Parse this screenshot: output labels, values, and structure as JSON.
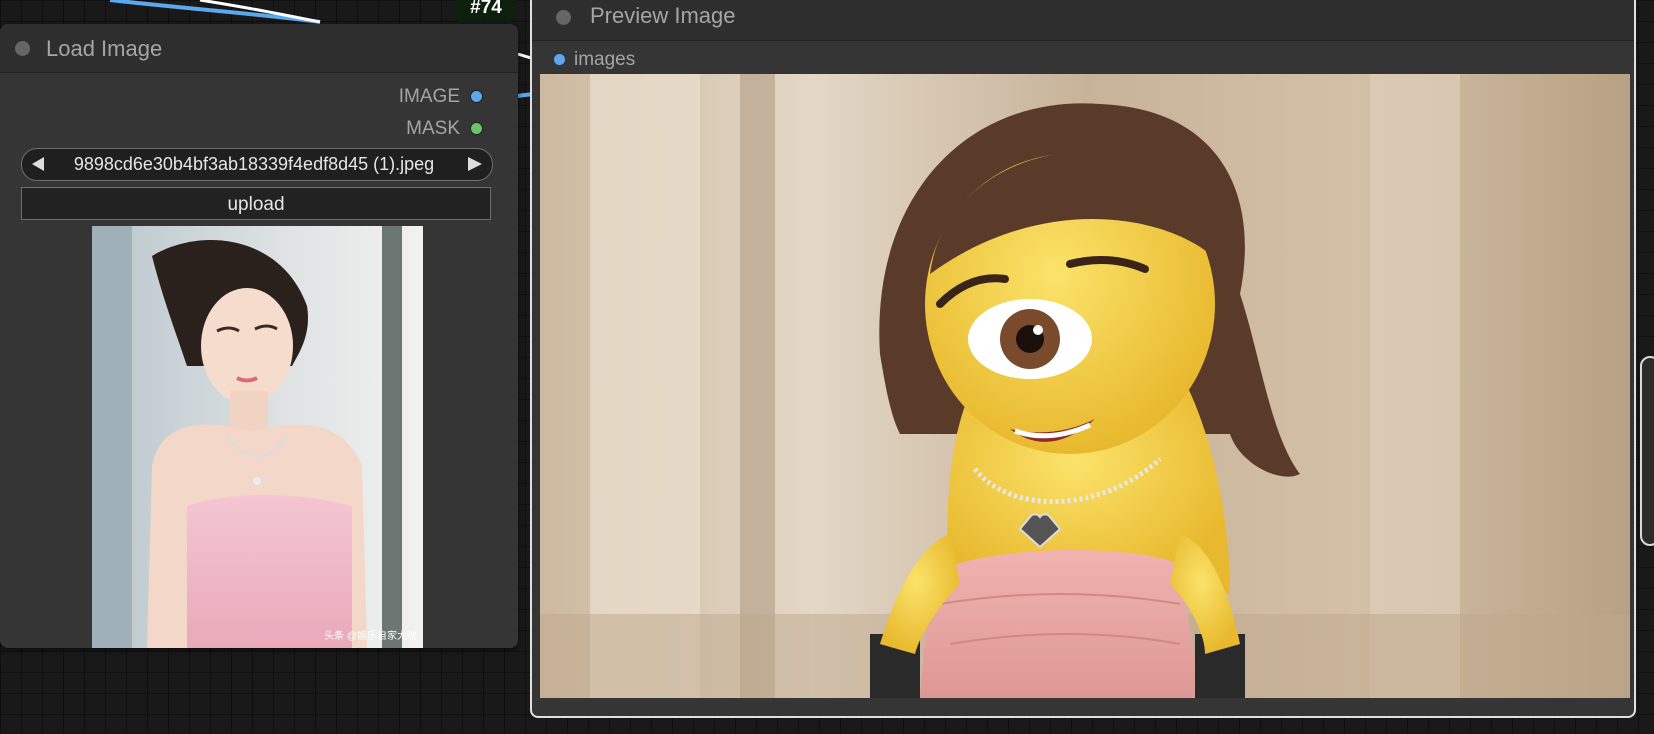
{
  "canvas": {
    "node_badge": "#74"
  },
  "load_image_node": {
    "title": "Load Image",
    "outputs": [
      {
        "label": "IMAGE",
        "color": "#5aa9ef"
      },
      {
        "label": "MASK",
        "color": "#6cc46c"
      }
    ],
    "image_combo": {
      "value": "9898cd6e30b4bf3ab18339f4edf8d45 (1).jpeg"
    },
    "upload_label": "upload",
    "thumbnail": {
      "subject": "woman-in-pink-strapless-dress-photo",
      "watermark": "头条 @娱乐自家大咖"
    }
  },
  "preview_image_node": {
    "title": "Preview Image",
    "inputs": [
      {
        "label": "images",
        "color": "#5aa9ef"
      }
    ],
    "image": {
      "subject": "yellow-one-eyed-minion-character-with-brown-hair-pink-dress"
    }
  },
  "colors": {
    "canvas_bg": "#191919",
    "node_bg": "#353535",
    "link_image": "#5aa9ef",
    "link_white": "#ffffff"
  }
}
